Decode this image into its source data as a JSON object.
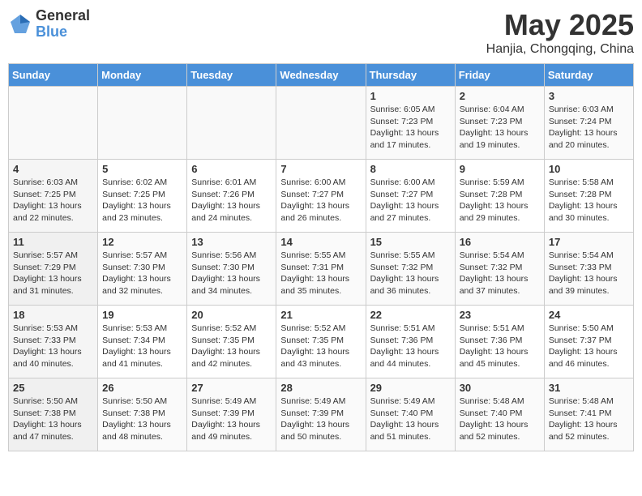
{
  "header": {
    "logo_general": "General",
    "logo_blue": "Blue",
    "month_year": "May 2025",
    "location": "Hanjia, Chongqing, China"
  },
  "days_of_week": [
    "Sunday",
    "Monday",
    "Tuesday",
    "Wednesday",
    "Thursday",
    "Friday",
    "Saturday"
  ],
  "weeks": [
    [
      {
        "day": "",
        "info": ""
      },
      {
        "day": "",
        "info": ""
      },
      {
        "day": "",
        "info": ""
      },
      {
        "day": "",
        "info": ""
      },
      {
        "day": "1",
        "info": "Sunrise: 6:05 AM\nSunset: 7:23 PM\nDaylight: 13 hours\nand 17 minutes."
      },
      {
        "day": "2",
        "info": "Sunrise: 6:04 AM\nSunset: 7:23 PM\nDaylight: 13 hours\nand 19 minutes."
      },
      {
        "day": "3",
        "info": "Sunrise: 6:03 AM\nSunset: 7:24 PM\nDaylight: 13 hours\nand 20 minutes."
      }
    ],
    [
      {
        "day": "4",
        "info": "Sunrise: 6:03 AM\nSunset: 7:25 PM\nDaylight: 13 hours\nand 22 minutes."
      },
      {
        "day": "5",
        "info": "Sunrise: 6:02 AM\nSunset: 7:25 PM\nDaylight: 13 hours\nand 23 minutes."
      },
      {
        "day": "6",
        "info": "Sunrise: 6:01 AM\nSunset: 7:26 PM\nDaylight: 13 hours\nand 24 minutes."
      },
      {
        "day": "7",
        "info": "Sunrise: 6:00 AM\nSunset: 7:27 PM\nDaylight: 13 hours\nand 26 minutes."
      },
      {
        "day": "8",
        "info": "Sunrise: 6:00 AM\nSunset: 7:27 PM\nDaylight: 13 hours\nand 27 minutes."
      },
      {
        "day": "9",
        "info": "Sunrise: 5:59 AM\nSunset: 7:28 PM\nDaylight: 13 hours\nand 29 minutes."
      },
      {
        "day": "10",
        "info": "Sunrise: 5:58 AM\nSunset: 7:28 PM\nDaylight: 13 hours\nand 30 minutes."
      }
    ],
    [
      {
        "day": "11",
        "info": "Sunrise: 5:57 AM\nSunset: 7:29 PM\nDaylight: 13 hours\nand 31 minutes."
      },
      {
        "day": "12",
        "info": "Sunrise: 5:57 AM\nSunset: 7:30 PM\nDaylight: 13 hours\nand 32 minutes."
      },
      {
        "day": "13",
        "info": "Sunrise: 5:56 AM\nSunset: 7:30 PM\nDaylight: 13 hours\nand 34 minutes."
      },
      {
        "day": "14",
        "info": "Sunrise: 5:55 AM\nSunset: 7:31 PM\nDaylight: 13 hours\nand 35 minutes."
      },
      {
        "day": "15",
        "info": "Sunrise: 5:55 AM\nSunset: 7:32 PM\nDaylight: 13 hours\nand 36 minutes."
      },
      {
        "day": "16",
        "info": "Sunrise: 5:54 AM\nSunset: 7:32 PM\nDaylight: 13 hours\nand 37 minutes."
      },
      {
        "day": "17",
        "info": "Sunrise: 5:54 AM\nSunset: 7:33 PM\nDaylight: 13 hours\nand 39 minutes."
      }
    ],
    [
      {
        "day": "18",
        "info": "Sunrise: 5:53 AM\nSunset: 7:33 PM\nDaylight: 13 hours\nand 40 minutes."
      },
      {
        "day": "19",
        "info": "Sunrise: 5:53 AM\nSunset: 7:34 PM\nDaylight: 13 hours\nand 41 minutes."
      },
      {
        "day": "20",
        "info": "Sunrise: 5:52 AM\nSunset: 7:35 PM\nDaylight: 13 hours\nand 42 minutes."
      },
      {
        "day": "21",
        "info": "Sunrise: 5:52 AM\nSunset: 7:35 PM\nDaylight: 13 hours\nand 43 minutes."
      },
      {
        "day": "22",
        "info": "Sunrise: 5:51 AM\nSunset: 7:36 PM\nDaylight: 13 hours\nand 44 minutes."
      },
      {
        "day": "23",
        "info": "Sunrise: 5:51 AM\nSunset: 7:36 PM\nDaylight: 13 hours\nand 45 minutes."
      },
      {
        "day": "24",
        "info": "Sunrise: 5:50 AM\nSunset: 7:37 PM\nDaylight: 13 hours\nand 46 minutes."
      }
    ],
    [
      {
        "day": "25",
        "info": "Sunrise: 5:50 AM\nSunset: 7:38 PM\nDaylight: 13 hours\nand 47 minutes."
      },
      {
        "day": "26",
        "info": "Sunrise: 5:50 AM\nSunset: 7:38 PM\nDaylight: 13 hours\nand 48 minutes."
      },
      {
        "day": "27",
        "info": "Sunrise: 5:49 AM\nSunset: 7:39 PM\nDaylight: 13 hours\nand 49 minutes."
      },
      {
        "day": "28",
        "info": "Sunrise: 5:49 AM\nSunset: 7:39 PM\nDaylight: 13 hours\nand 50 minutes."
      },
      {
        "day": "29",
        "info": "Sunrise: 5:49 AM\nSunset: 7:40 PM\nDaylight: 13 hours\nand 51 minutes."
      },
      {
        "day": "30",
        "info": "Sunrise: 5:48 AM\nSunset: 7:40 PM\nDaylight: 13 hours\nand 52 minutes."
      },
      {
        "day": "31",
        "info": "Sunrise: 5:48 AM\nSunset: 7:41 PM\nDaylight: 13 hours\nand 52 minutes."
      }
    ]
  ]
}
